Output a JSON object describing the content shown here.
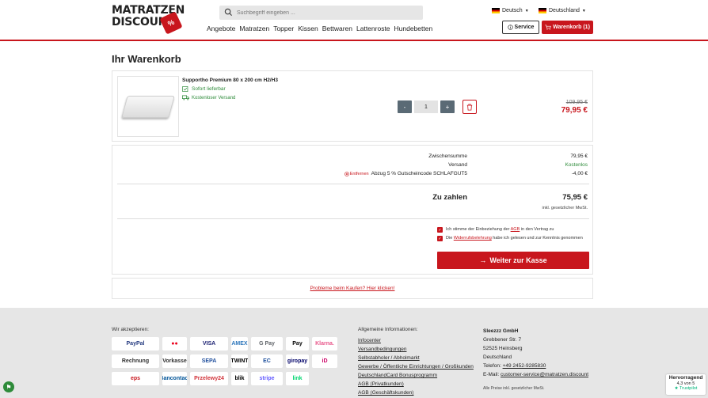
{
  "brand": {
    "line1": "MATRATZEN",
    "line2": "DISCOUNT",
    "tag": "%"
  },
  "search": {
    "placeholder": "Suchbegriff eingeben ..."
  },
  "nav": [
    "Angebote",
    "Matratzen",
    "Topper",
    "Kissen",
    "Bettwaren",
    "Lattenroste",
    "Hundebetten"
  ],
  "header": {
    "language": "Deutsch",
    "country": "Deutschland",
    "service_label": "Service",
    "cart_label": "Warenkorb (1)"
  },
  "page_title": "Ihr Warenkorb",
  "item": {
    "name": "Supportho Premium 80 x 200 cm H2/H3",
    "availability": "Sofort lieferbar",
    "shipping": "Kostenloser Versand",
    "qty_minus": "-",
    "quantity": "1",
    "qty_plus": "+",
    "old_price": "109,95 €",
    "price": "79,95 €"
  },
  "summary": {
    "subtotal_label": "Zwischensumme",
    "subtotal_value": "79,95 €",
    "shipping_label": "Versand",
    "shipping_value": "Kostenlos",
    "remove_label": "Entfernen",
    "discount_label": "Abzug 5 % Gutscheincode SCHLAFGUT5",
    "discount_value": "-4,00 €",
    "total_label": "Zu zahlen",
    "total_value": "75,95 €",
    "tax_note": "inkl. gesetzlicher MwSt.",
    "terms_pre": "Ich stimme der Einbeziehung der ",
    "terms_link": "AGB",
    "terms_post": " in den Vertrag zu",
    "withdraw_pre": "Die ",
    "withdraw_link": "Widerrufsbelehrung",
    "withdraw_post": " habe ich gelesen und zur Kenntnis genommen",
    "checkout_label": "Weiter zur Kasse"
  },
  "help_link": "Probleme beim Kaufen? Hier klicken!",
  "footer": {
    "accept_title": "Wir akzeptieren:",
    "payments": [
      {
        "label": "PayPal",
        "color": "#253b80"
      },
      {
        "label": "●●",
        "color": "#eb001b"
      },
      {
        "label": "VISA",
        "color": "#1a1f71"
      },
      {
        "label": "AMEX",
        "color": "#2e77bb"
      },
      {
        "label": "G Pay",
        "color": "#5f6368"
      },
      {
        "label": "Pay",
        "color": "#000000"
      },
      {
        "label": "Klarna.",
        "color": "#e8578b"
      },
      {
        "label": "Rechnung",
        "color": "#333333"
      },
      {
        "label": "Vorkasse",
        "color": "#333333"
      },
      {
        "label": "SEPA",
        "color": "#1f4e9c"
      },
      {
        "label": "TWINT",
        "color": "#000000"
      },
      {
        "label": "EC",
        "color": "#1c4f9c"
      },
      {
        "label": "giropay",
        "color": "#000268"
      },
      {
        "label": "iD",
        "color": "#cc0066"
      },
      {
        "label": "eps",
        "color": "#c8161d"
      },
      {
        "label": "Bancontact",
        "color": "#005498"
      },
      {
        "label": "Przelewy24",
        "color": "#d13239"
      },
      {
        "label": "blik",
        "color": "#000000"
      },
      {
        "label": "stripe",
        "color": "#635bff"
      },
      {
        "label": "link",
        "color": "#00d66f"
      }
    ],
    "info_title": "Allgemeine Informationen:",
    "links": [
      "Infocenter",
      "Versandbedingungen",
      "Selbstabholer / Abholmarkt",
      "Gewerbe / Öffentliche Einrichtungen / Großkunden",
      "DeutschlandCard Bonusprogramm",
      "AGB (Privatkunden)",
      "AGB (Geschäftskunden)"
    ],
    "company": {
      "name": "Sleezzz GmbH",
      "street": "Grebbener Str. 7",
      "city": "52525 Heinsberg",
      "country": "Deutschland",
      "phone_label": "Telefon: ",
      "phone": "+49 2452-9285830",
      "email_label": "E-Mail: ",
      "email": "customer-service@matratzen.discount"
    },
    "price_note": "Alle Preise inkl. gesetzlicher MwSt."
  },
  "trustpilot": {
    "rating_label": "Hervorragend",
    "score": "4,3 von 5",
    "brand": "★ Trustpilot"
  }
}
